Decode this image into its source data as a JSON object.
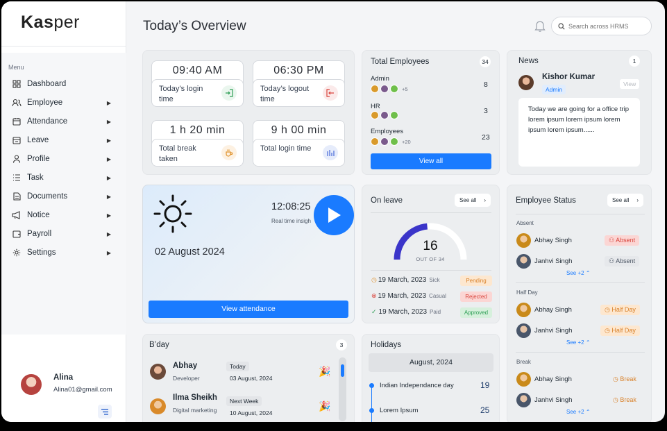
{
  "app": {
    "logo_bold": "Kas",
    "logo_rest": "per"
  },
  "sidebar": {
    "menu_caption": "Menu",
    "items": [
      {
        "label": "Dashboard",
        "icon": "grid-icon"
      },
      {
        "label": "Employee",
        "icon": "users-icon"
      },
      {
        "label": "Attendance",
        "icon": "calendar-icon"
      },
      {
        "label": "Leave",
        "icon": "leave-calendar-icon"
      },
      {
        "label": "Profile",
        "icon": "user-icon"
      },
      {
        "label": "Task",
        "icon": "list-icon"
      },
      {
        "label": "Documents",
        "icon": "document-icon"
      },
      {
        "label": "Notice",
        "icon": "megaphone-icon"
      },
      {
        "label": "Payroll",
        "icon": "wallet-icon"
      },
      {
        "label": "Settings",
        "icon": "gear-icon"
      }
    ],
    "user": {
      "name": "Alina",
      "email": "Alina01@gmail.com"
    }
  },
  "header": {
    "title": "Today’s Overview",
    "search_placeholder": "Search across HRMS"
  },
  "time_cards": [
    {
      "time": "09:40 AM",
      "label": "Today’s login time",
      "icon": "login-icon",
      "color": "#2e9e55"
    },
    {
      "time": "06:30 PM",
      "label": "Today’s logout time",
      "icon": "logout-icon",
      "color": "#d9453d"
    },
    {
      "time": "1 h 20 min",
      "label": "Total break taken",
      "icon": "coffee-icon",
      "color": "#e0922b"
    },
    {
      "time": "9 h 00 min",
      "label": "Total login time",
      "icon": "stats-icon",
      "color": "#4669d8"
    }
  ],
  "total_employees": {
    "title": "Total Employees",
    "count": "34",
    "groups": [
      {
        "label": "Admin",
        "count": "8",
        "more": "+5"
      },
      {
        "label": "HR",
        "count": "3",
        "more": ""
      },
      {
        "label": "Employees",
        "count": "23",
        "more": "+20"
      }
    ],
    "button": "View all"
  },
  "news": {
    "title": "News",
    "count": "1",
    "author": "Kishor Kumar",
    "role": "Admin",
    "view": "View",
    "text": "Today we are going for a office trip lorem ipsum lorem ipsum lorem ipsum lorem ipsum......"
  },
  "weather": {
    "date": "02 August 2024",
    "clock": "12:08:25",
    "caption": "Real time insigh",
    "button": "View attendance"
  },
  "on_leave": {
    "title": "On leave",
    "see_all": "See all",
    "value": 16,
    "total": 34,
    "count": "16",
    "out_of": "OUT OF 34",
    "rows": [
      {
        "date": "19 March, 2023",
        "kind": "Sick",
        "status": "Pending"
      },
      {
        "date": "19 March, 2023",
        "kind": "Casual",
        "status": "Rejected"
      },
      {
        "date": "19 March, 2023",
        "kind": "Paid",
        "status": "Approved"
      }
    ]
  },
  "employee_status": {
    "title": "Employee Status",
    "see_all": "See all",
    "sections": [
      {
        "label": "Absent",
        "rows": [
          {
            "name": "Abhay Singh",
            "status": "Absent"
          },
          {
            "name": "Janhvi Singh",
            "status": "Absent"
          }
        ],
        "more": "See +2"
      },
      {
        "label": "Half Day",
        "rows": [
          {
            "name": "Abhay Singh",
            "status": "Half Day"
          },
          {
            "name": "Janhvi Singh",
            "status": "Half Day"
          }
        ],
        "more": "See +2"
      },
      {
        "label": "Break",
        "rows": [
          {
            "name": "Abhay Singh",
            "status": "Break"
          },
          {
            "name": "Janhvi Singh",
            "status": "Break"
          }
        ],
        "more": "See +2"
      }
    ]
  },
  "birthdays": {
    "title": "B’day",
    "count": "3",
    "rows": [
      {
        "name": "Abhay",
        "role": "Developer",
        "when": "Today",
        "date": "03 August, 2024"
      },
      {
        "name": "Ilma Sheikh",
        "role": "Digital marketing",
        "when": "Next Week",
        "date": "10 August, 2024"
      }
    ]
  },
  "holidays": {
    "title": "Holidays",
    "month": "August, 2024",
    "rows": [
      {
        "name": "Indian Independance day",
        "day": "19"
      },
      {
        "name": "Lorem Ipsum",
        "day": "25"
      }
    ]
  }
}
